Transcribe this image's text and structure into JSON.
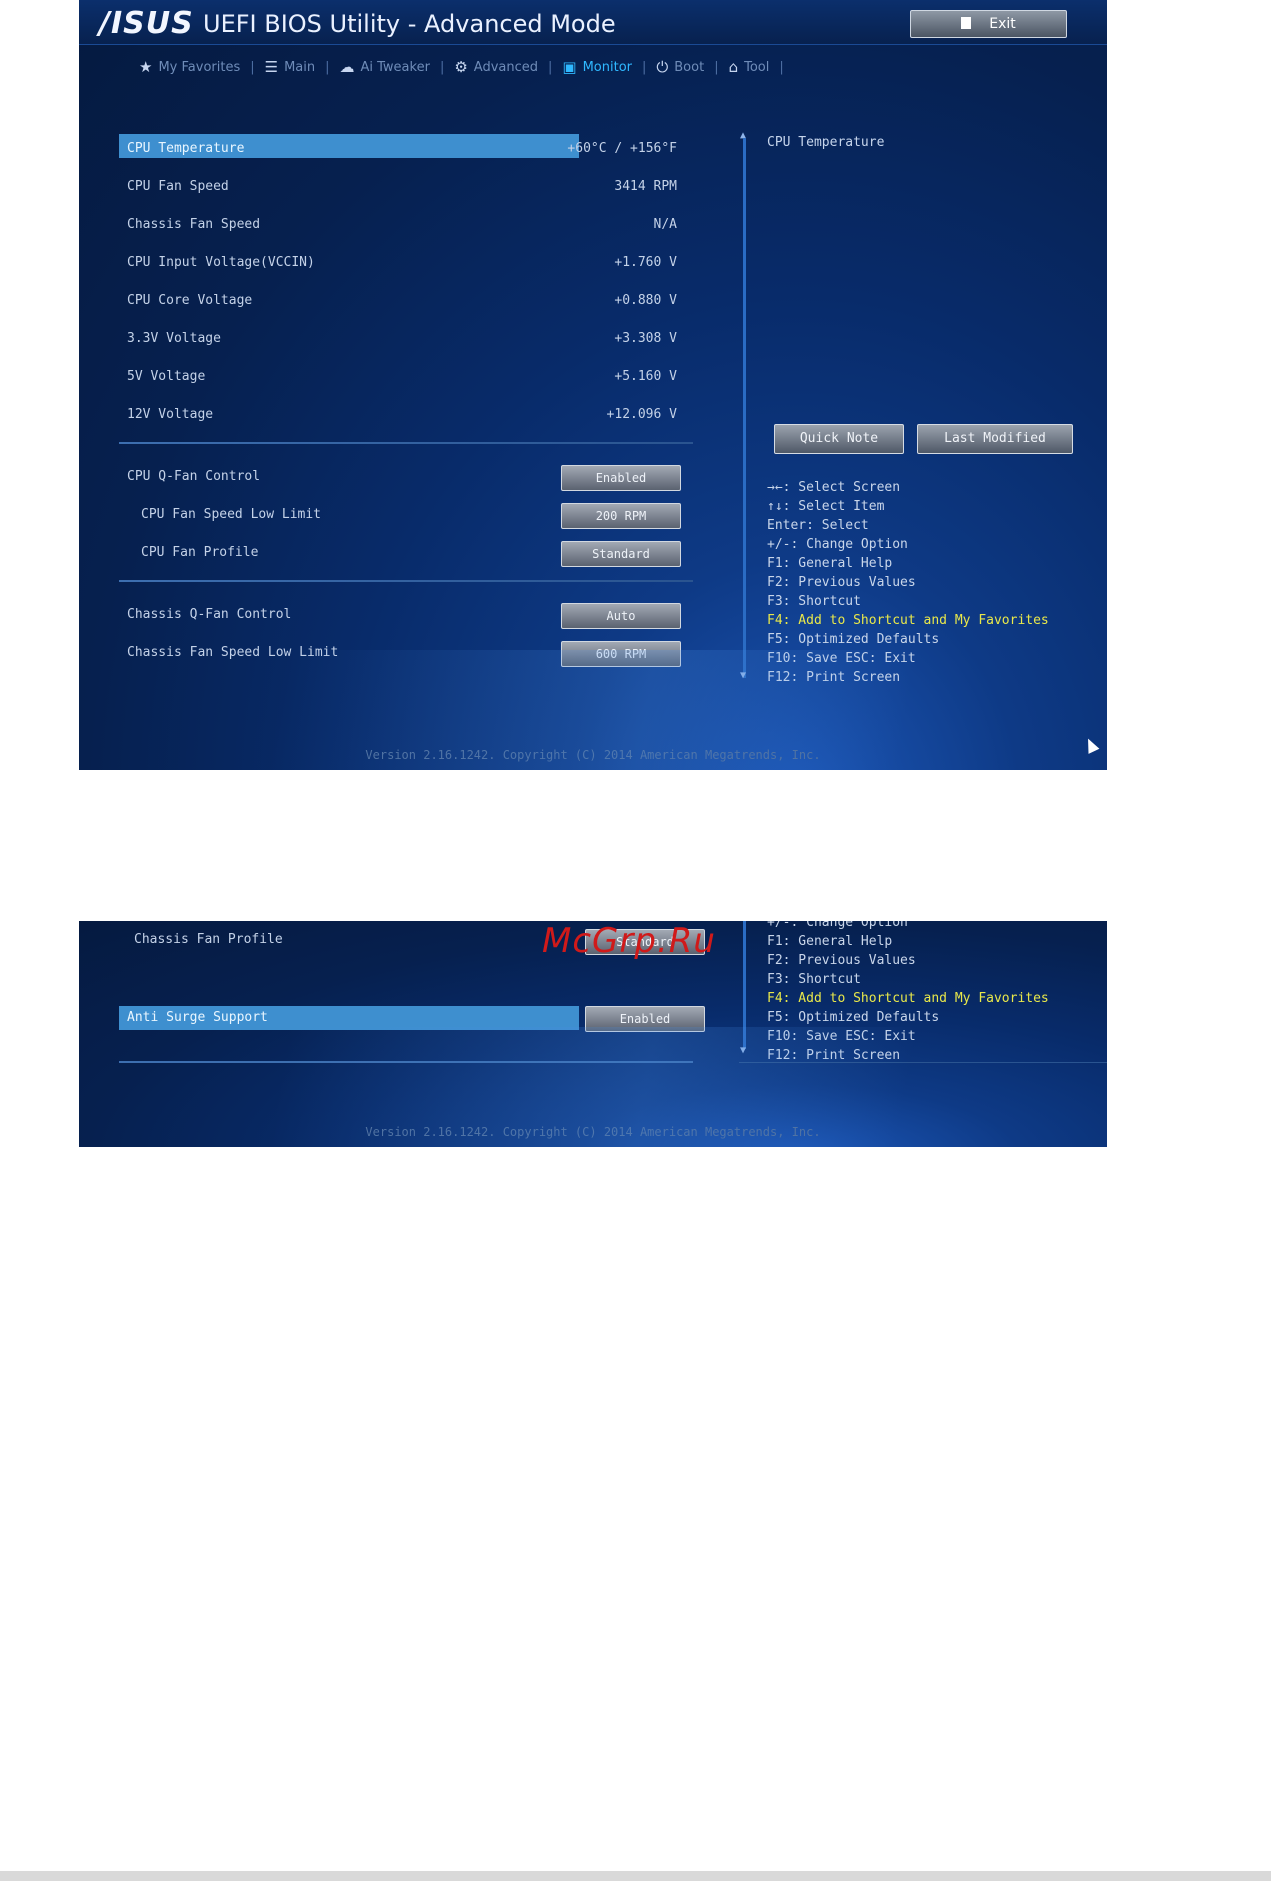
{
  "header": {
    "logo": "/ISUS",
    "title": "UEFI BIOS Utility - Advanced Mode",
    "exit_label": "Exit"
  },
  "tabs": [
    {
      "icon": "★",
      "label": "My Favorites"
    },
    {
      "icon": "☰",
      "label": "Main"
    },
    {
      "icon": "☁",
      "label": "Ai Tweaker"
    },
    {
      "icon": "⚙",
      "label": "Advanced"
    },
    {
      "icon": "▣",
      "label": "Monitor"
    },
    {
      "icon": "⏻",
      "label": "Boot"
    },
    {
      "icon": "⌂",
      "label": "Tool"
    }
  ],
  "monitor": {
    "readings": [
      {
        "label": "CPU Temperature",
        "value": "+60°C / +156°F"
      },
      {
        "label": "CPU Fan Speed",
        "value": "3414 RPM"
      },
      {
        "label": "Chassis Fan Speed",
        "value": "N/A"
      },
      {
        "label": "CPU Input Voltage(VCCIN)",
        "value": "+1.760 V"
      },
      {
        "label": "CPU Core Voltage",
        "value": "+0.880 V"
      },
      {
        "label": "3.3V Voltage",
        "value": "+3.308 V"
      },
      {
        "label": "5V Voltage",
        "value": "+5.160 V"
      },
      {
        "label": "12V Voltage",
        "value": "+12.096 V"
      }
    ],
    "cpu_fan": [
      {
        "label": "CPU Q-Fan Control",
        "value": "Enabled"
      },
      {
        "label": "CPU Fan Speed Low Limit",
        "value": "200 RPM"
      },
      {
        "label": "CPU Fan Profile",
        "value": "Standard"
      }
    ],
    "chassis_fan": [
      {
        "label": "Chassis Q-Fan Control",
        "value": "Auto"
      },
      {
        "label": "Chassis Fan Speed Low Limit",
        "value": "600 RPM"
      }
    ]
  },
  "help": {
    "title": "CPU Temperature",
    "quick_note": "Quick Note",
    "last_modified": "Last Modified",
    "keys": [
      "→←: Select Screen",
      "↑↓: Select Item",
      "Enter: Select",
      "+/-: Change Option",
      "F1: General Help",
      "F2: Previous Values",
      "F3: Shortcut",
      "F4: Add to Shortcut and My Favorites",
      "F5: Optimized Defaults",
      "F10: Save  ESC: Exit",
      "F12: Print Screen"
    ]
  },
  "footer": "Version 2.16.1242. Copyright (C) 2014 American Megatrends, Inc.",
  "screen2": {
    "chassis_fan_profile_label": "Chassis Fan Profile",
    "chassis_fan_profile_value": "Standard",
    "anti_surge_label": "Anti Surge Support",
    "anti_surge_value": "Enabled",
    "keys": [
      "+/-: Change Option",
      "F1: General Help",
      "F2: Previous Values",
      "F3: Shortcut",
      "F4: Add to Shortcut and My Favorites",
      "F5: Optimized Defaults",
      "F10: Save  ESC: Exit",
      "F12: Print Screen"
    ]
  },
  "watermark": "McGrp.Ru",
  "colors": {
    "highlight": "#3e8fcf",
    "active_tab": "#2fb8ff",
    "key_highlight": "#e9e84a"
  }
}
